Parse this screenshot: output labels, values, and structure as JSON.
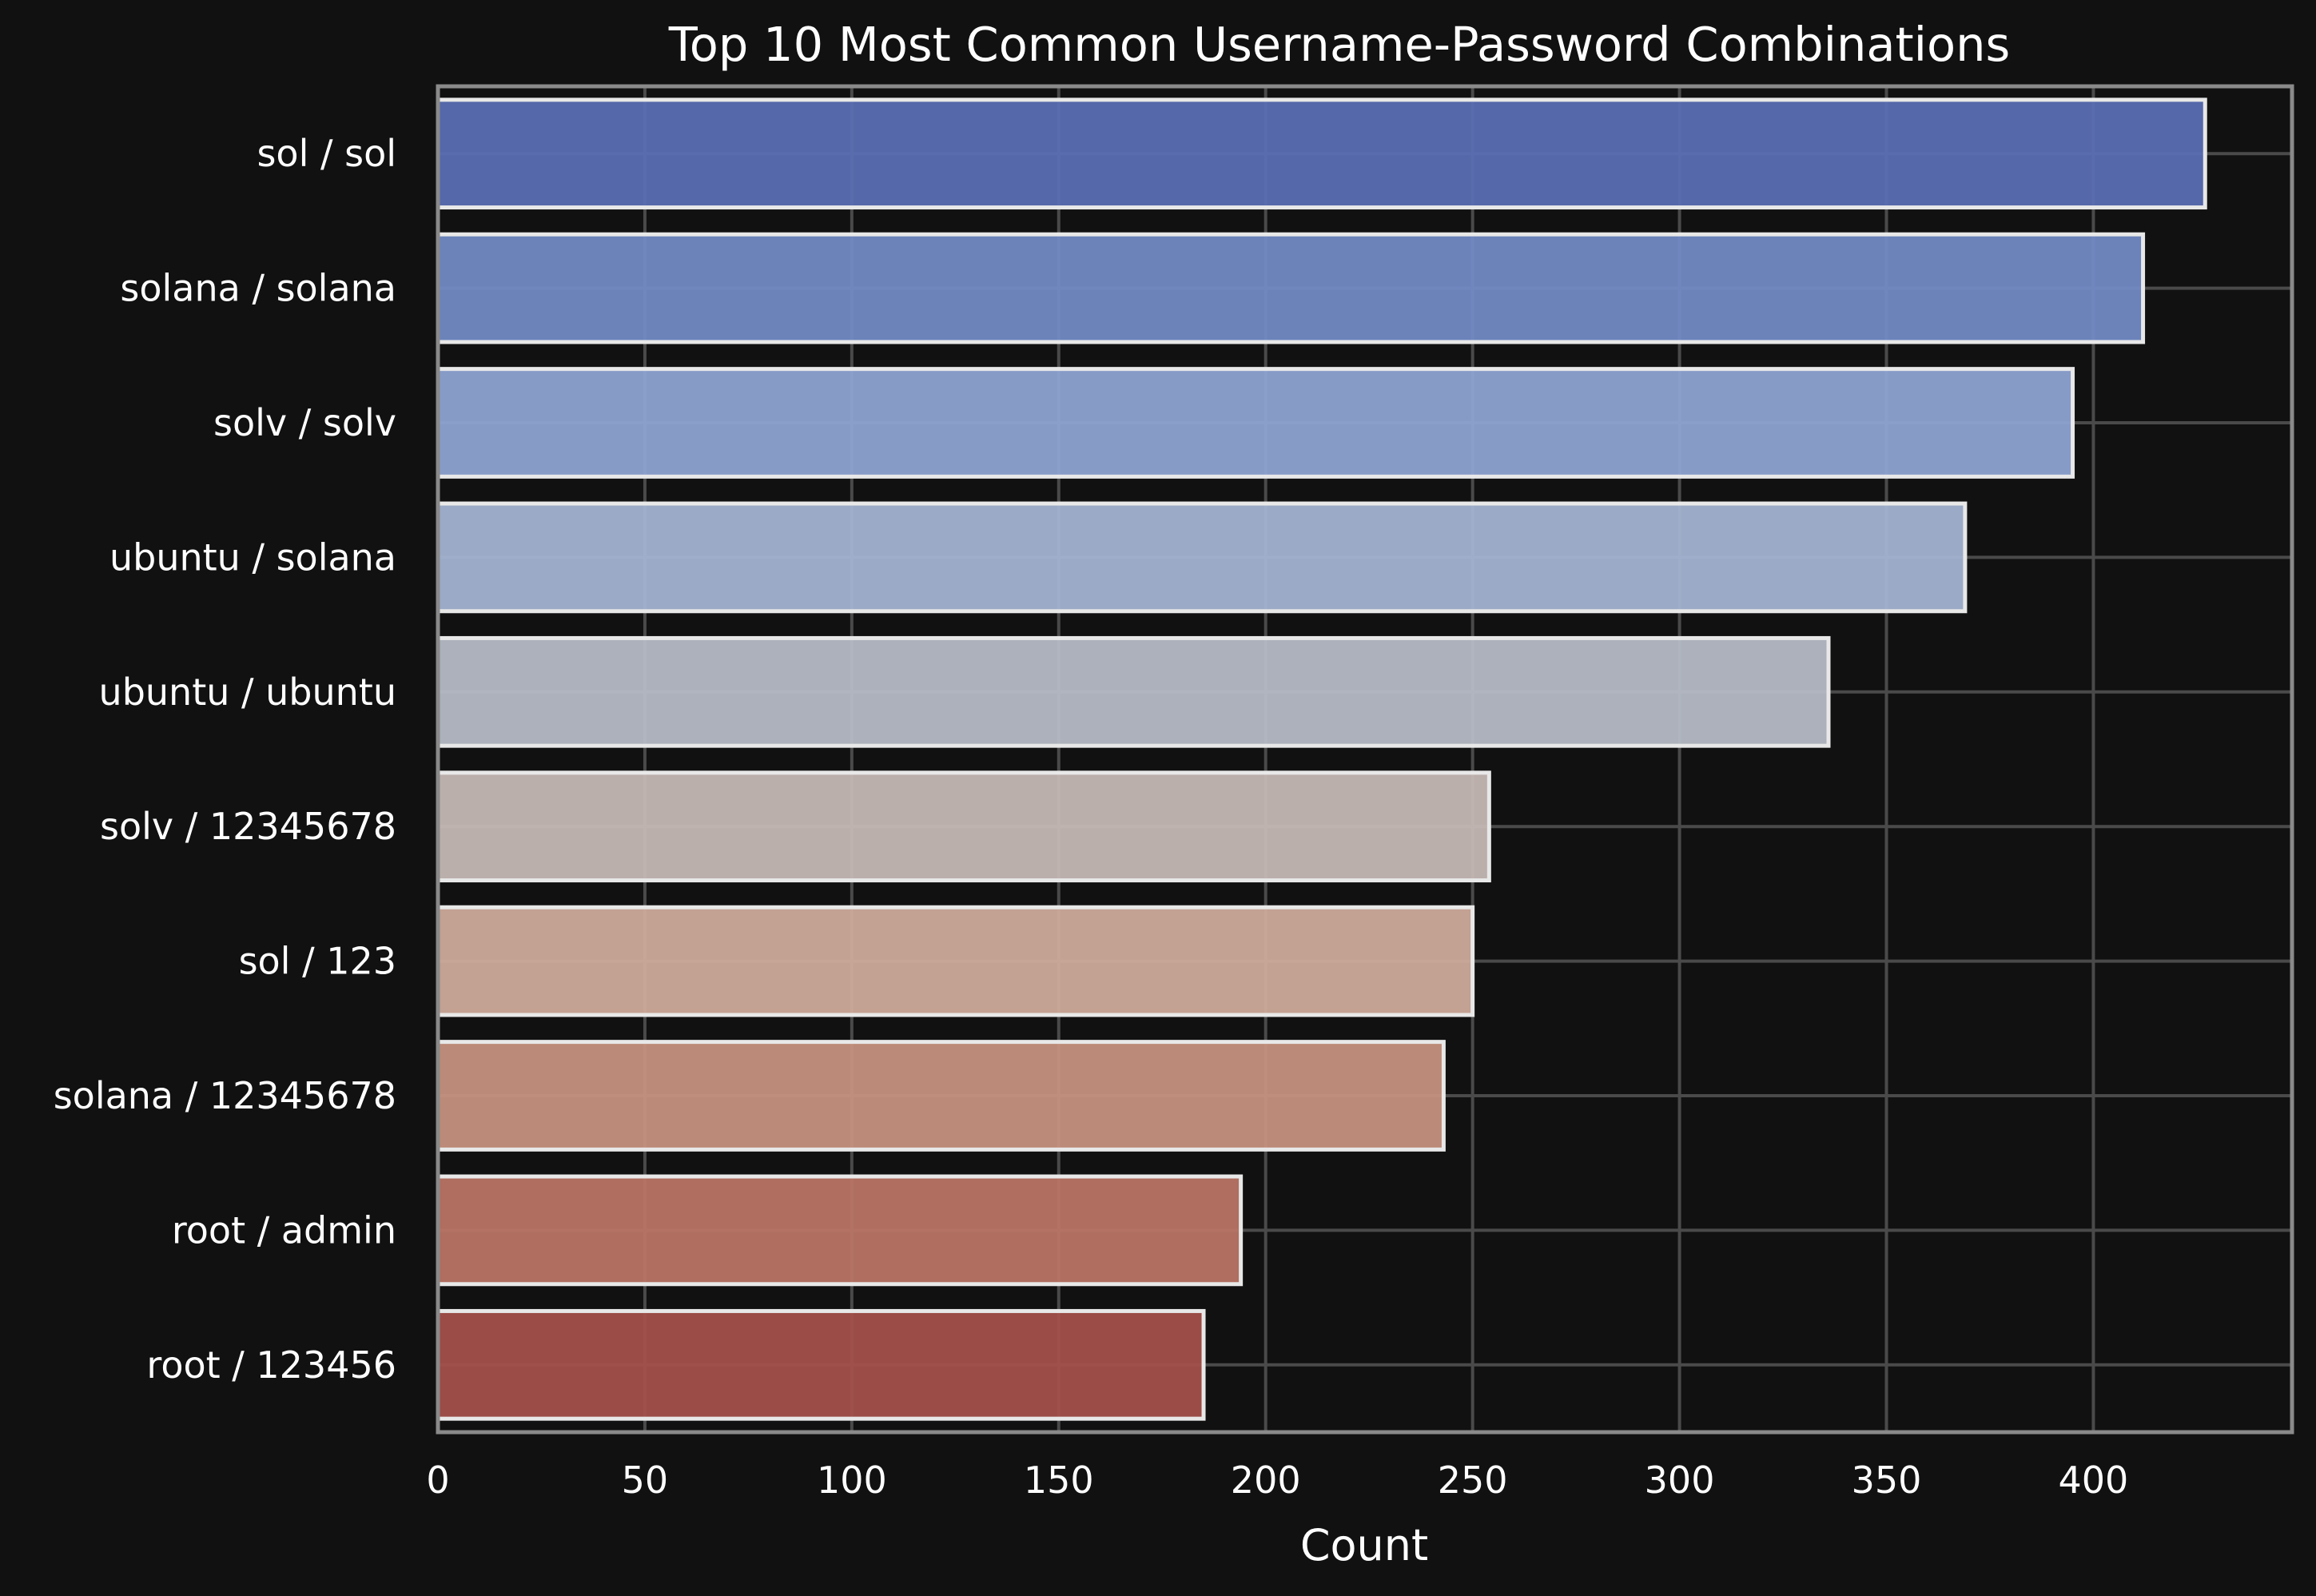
{
  "colors": {
    "background": "#111111",
    "plot_background": "#111111",
    "grid": "#4a4a4a",
    "frame": "#8a8a8a",
    "bar_edge": "#e8e8e8",
    "text": "#ffffff"
  },
  "chart_data": {
    "type": "bar",
    "orientation": "horizontal",
    "title": "Top 10 Most Common Username-Password Combinations",
    "xlabel": "Count",
    "ylabel": "",
    "xlim": [
      0,
      448
    ],
    "xticks": [
      0,
      50,
      100,
      150,
      200,
      250,
      300,
      350,
      400
    ],
    "grid": true,
    "categories": [
      "sol / sol",
      "solana / solana",
      "solv / solv",
      "ubuntu / solana",
      "ubuntu / ubuntu",
      "solv / 12345678",
      "sol / 123",
      "solana / 12345678",
      "root / admin",
      "root / 123456"
    ],
    "values": [
      427,
      412,
      395,
      369,
      336,
      254,
      250,
      243,
      194,
      185
    ],
    "bar_colors": [
      "#5a6eb2",
      "#728ac4",
      "#8ea3d2",
      "#a3b3d1",
      "#b5bbc5",
      "#c5b8b4",
      "#ceaa9b",
      "#c6917e",
      "#b87465",
      "#a3504b"
    ]
  }
}
